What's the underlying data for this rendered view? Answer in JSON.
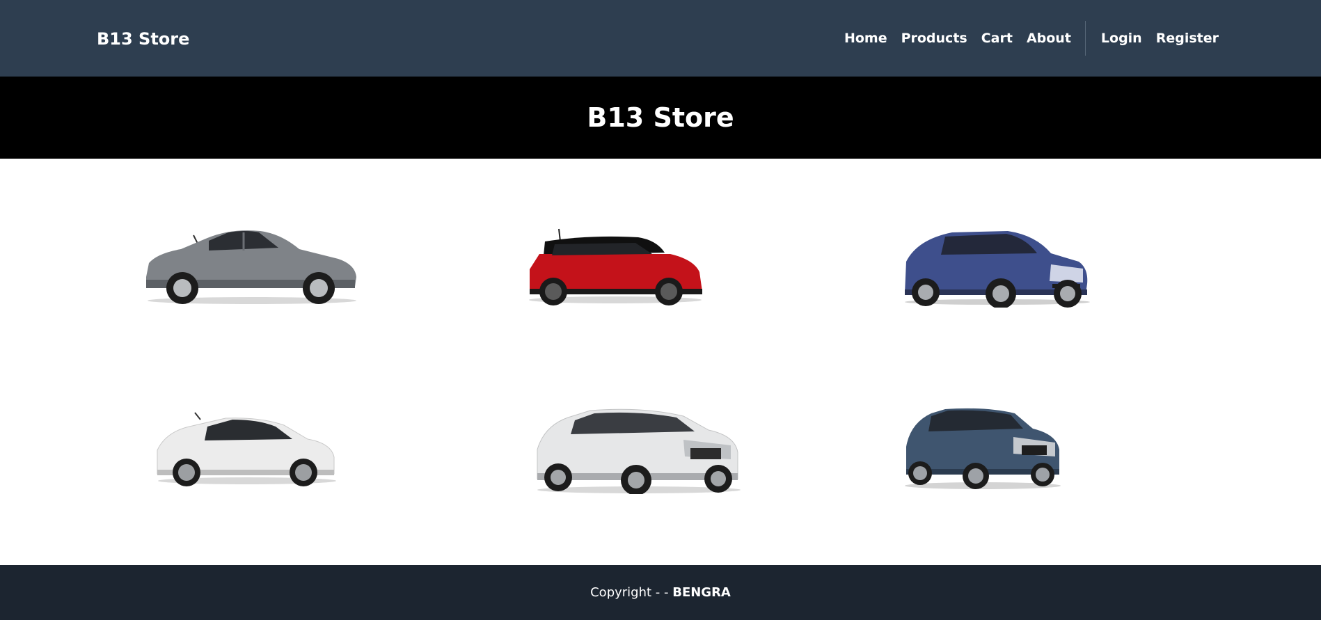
{
  "navbar": {
    "brand": "B13 Store",
    "links": {
      "home": "Home",
      "products": "Products",
      "cart": "Cart",
      "about": "About",
      "login": "Login",
      "register": "Register"
    },
    "background": "#2e3e50"
  },
  "hero": {
    "title": "B13 Store",
    "background": "#000000"
  },
  "products": [
    {
      "name": "gray-sedan",
      "color": "#7c8084"
    },
    {
      "name": "red-hatchback",
      "color": "#c4121a"
    },
    {
      "name": "blue-sedan",
      "color": "#3e4f8c"
    },
    {
      "name": "white-hatchback",
      "color": "#ececec"
    },
    {
      "name": "white-suv",
      "color": "#e6e7e8"
    },
    {
      "name": "blue-gray-suv",
      "color": "#3f556f"
    }
  ],
  "footer": {
    "prefix": "Copyright - - ",
    "author": "BENGRA",
    "background": "#1c2530"
  }
}
